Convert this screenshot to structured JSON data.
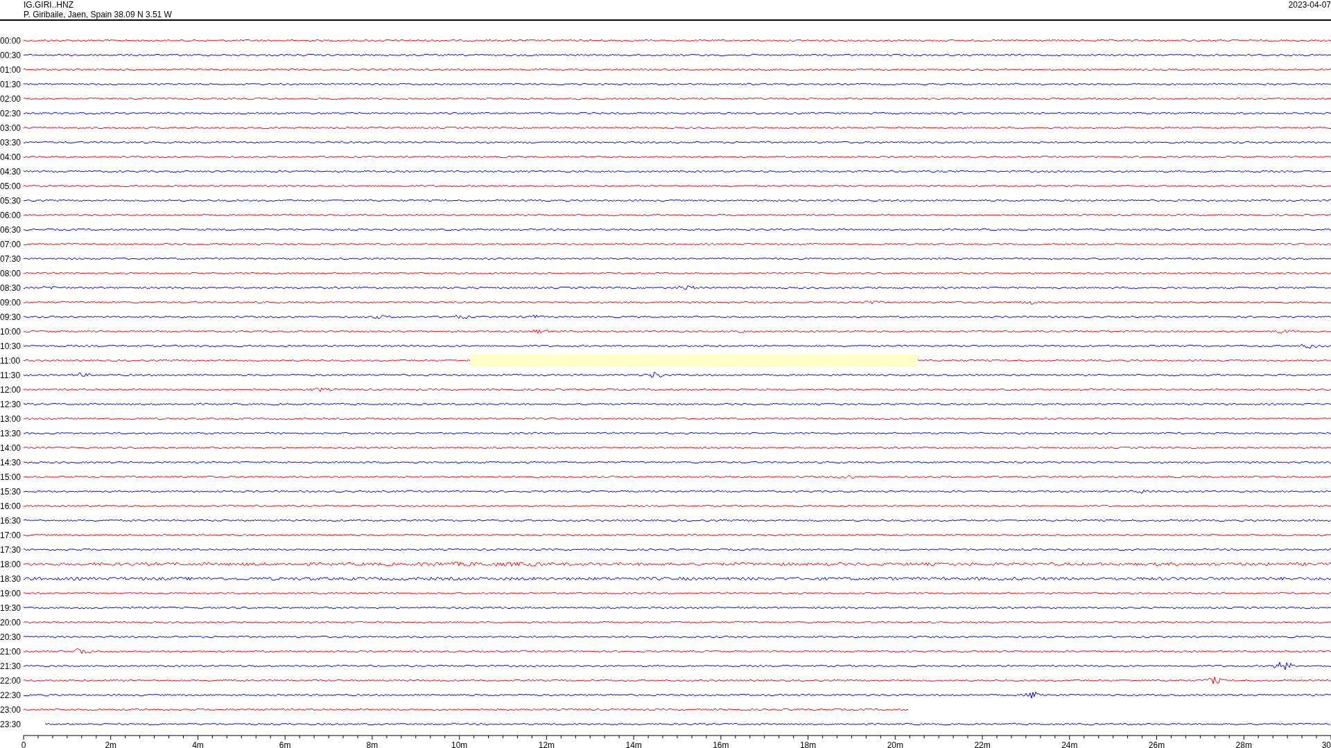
{
  "header": {
    "station": "IG.GIRI..HNZ",
    "location": "P. Giribaile, Jaen, Spain  38.09 N 3.51 W",
    "date": "2023-04-07"
  },
  "rows": [
    {
      "time": "00:00",
      "color": "#ff0000"
    },
    {
      "time": "00:30",
      "color": "#0000ff"
    },
    {
      "time": "01:00",
      "color": "#ff0000"
    },
    {
      "time": "01:30",
      "color": "#0000ff"
    },
    {
      "time": "02:00",
      "color": "#ff0000"
    },
    {
      "time": "02:30",
      "color": "#0000ff"
    },
    {
      "time": "03:00",
      "color": "#ff0000"
    },
    {
      "time": "03:30",
      "color": "#0000ff"
    },
    {
      "time": "04:00",
      "color": "#ff0000"
    },
    {
      "time": "04:30",
      "color": "#0000ff"
    },
    {
      "time": "05:00",
      "color": "#ff0000"
    },
    {
      "time": "05:30",
      "color": "#0000ff"
    },
    {
      "time": "06:00",
      "color": "#ff0000"
    },
    {
      "time": "06:30",
      "color": "#0000ff"
    },
    {
      "time": "07:00",
      "color": "#ff0000"
    },
    {
      "time": "07:30",
      "color": "#0000ff"
    },
    {
      "time": "08:00",
      "color": "#ff0000"
    },
    {
      "time": "08:30",
      "color": "#0000ff"
    },
    {
      "time": "09:00",
      "color": "#ff0000"
    },
    {
      "time": "09:30",
      "color": "#0000ff"
    },
    {
      "time": "10:00",
      "color": "#ff0000"
    },
    {
      "time": "10:30",
      "color": "#0000ff"
    },
    {
      "time": "11:00",
      "color": "#ff0000"
    },
    {
      "time": "11:30",
      "color": "#0000ff"
    },
    {
      "time": "12:00",
      "color": "#ff0000"
    },
    {
      "time": "12:30",
      "color": "#0000ff"
    },
    {
      "time": "13:00",
      "color": "#ff0000"
    },
    {
      "time": "13:30",
      "color": "#0000ff"
    },
    {
      "time": "14:00",
      "color": "#ff0000"
    },
    {
      "time": "14:30",
      "color": "#0000ff"
    },
    {
      "time": "15:00",
      "color": "#ff0000"
    },
    {
      "time": "15:30",
      "color": "#0000ff"
    },
    {
      "time": "16:00",
      "color": "#ff0000"
    },
    {
      "time": "16:30",
      "color": "#0000ff"
    },
    {
      "time": "17:00",
      "color": "#ff0000"
    },
    {
      "time": "17:30",
      "color": "#0000ff"
    },
    {
      "time": "18:00",
      "color": "#ff0000"
    },
    {
      "time": "18:30",
      "color": "#0000ff"
    },
    {
      "time": "19:00",
      "color": "#ff0000"
    },
    {
      "time": "19:30",
      "color": "#0000ff"
    },
    {
      "time": "20:00",
      "color": "#ff0000"
    },
    {
      "time": "20:30",
      "color": "#0000ff"
    },
    {
      "time": "21:00",
      "color": "#ff0000"
    },
    {
      "time": "21:30",
      "color": "#0000ff"
    },
    {
      "time": "22:00",
      "color": "#ff0000"
    },
    {
      "time": "22:30",
      "color": "#0000ff"
    },
    {
      "time": "23:00",
      "color": "#ff0000"
    },
    {
      "time": "23:30",
      "color": "#0000ff"
    }
  ],
  "axis": {
    "ticks": [
      "0",
      "2m",
      "4m",
      "6m",
      "8m",
      "10m",
      "12m",
      "14m",
      "16m",
      "18m",
      "20m",
      "22m",
      "24m",
      "26m",
      "28m",
      "30"
    ]
  }
}
